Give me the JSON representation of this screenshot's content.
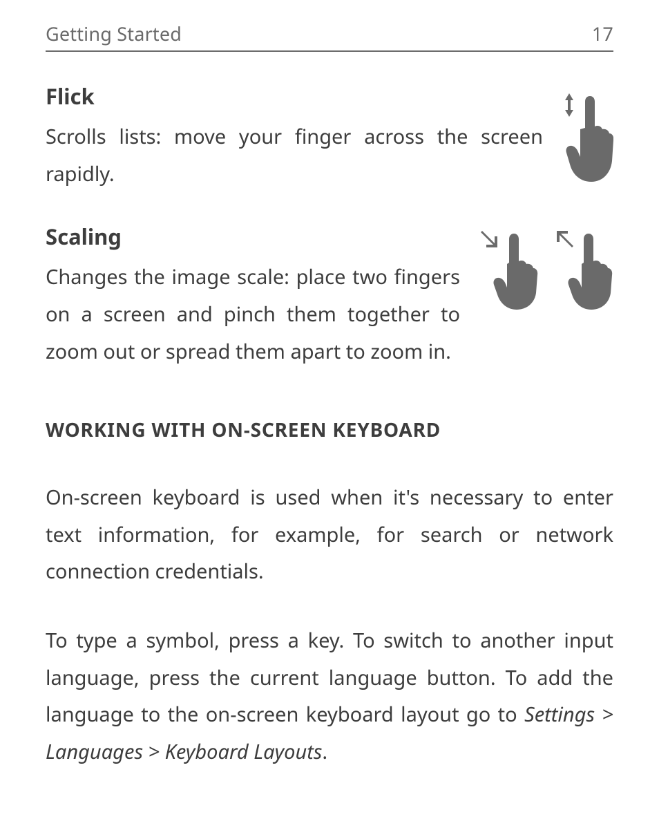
{
  "header": {
    "section": "Getting Started",
    "page_number": "17"
  },
  "gestures": {
    "flick": {
      "title": "Flick",
      "description": "Scrolls lists: move your finger across the screen rapidly."
    },
    "scaling": {
      "title": "Scaling",
      "description": "Changes the image scale: place two fingers on a screen and pinch them together to zoom out or spread them apart to zoom in."
    }
  },
  "keyboard_section": {
    "heading": "WORKING WITH ON-SCREEN KEYBOARD",
    "paragraph1": "On-screen keyboard is used when it's necessary to enter text information, for example, for search or network connection credentials.",
    "paragraph2_lead": "To type a symbol, press a key. To switch to another input language, press the current language button. To add the language to the on-screen keyboard layout go to ",
    "paragraph2_path": "Settings > Languages > Keyboard Layouts",
    "paragraph2_tail": "."
  }
}
